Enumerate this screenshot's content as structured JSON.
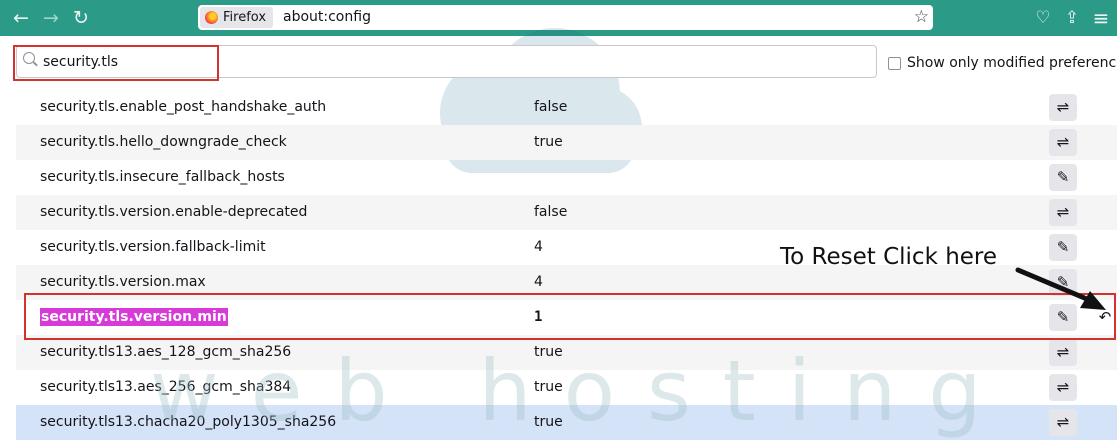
{
  "browser": {
    "nav_back": "←",
    "nav_forward": "→",
    "nav_reload": "↻",
    "identity_label": "Firefox",
    "url": "about:config",
    "bookmark_star": "☆",
    "toolbar_icons": [
      "pocket-icon",
      "share-icon",
      "menu-icon"
    ],
    "pocket_glyph": "♡",
    "share_glyph": "⇪",
    "menu_glyph": "≡",
    "accent_color": "#2b9a86"
  },
  "search": {
    "value": "security.tls",
    "show_modified_label": "Show only modified preferences"
  },
  "prefs": [
    {
      "name": "security.tls.enable_post_handshake_auth",
      "value": "false",
      "action": "toggle"
    },
    {
      "name": "security.tls.hello_downgrade_check",
      "value": "true",
      "action": "toggle"
    },
    {
      "name": "security.tls.insecure_fallback_hosts",
      "value": "",
      "action": "edit"
    },
    {
      "name": "security.tls.version.enable-deprecated",
      "value": "false",
      "action": "toggle"
    },
    {
      "name": "security.tls.version.fallback-limit",
      "value": "4",
      "action": "edit"
    },
    {
      "name": "security.tls.version.max",
      "value": "4",
      "action": "edit"
    },
    {
      "name": "security.tls.version.min",
      "value": "1",
      "action": "edit",
      "modified": true
    },
    {
      "name": "security.tls13.aes_128_gcm_sha256",
      "value": "true",
      "action": "toggle"
    },
    {
      "name": "security.tls13.aes_256_gcm_sha384",
      "value": "true",
      "action": "toggle"
    },
    {
      "name": "security.tls13.chacha20_poly1305_sha256",
      "value": "true",
      "action": "toggle"
    }
  ],
  "icons": {
    "toggle": "⇌",
    "edit": "✎",
    "reset": "↶"
  },
  "annotation": {
    "text": "To Reset Click here"
  },
  "watermark": {
    "text": "web hosting"
  }
}
